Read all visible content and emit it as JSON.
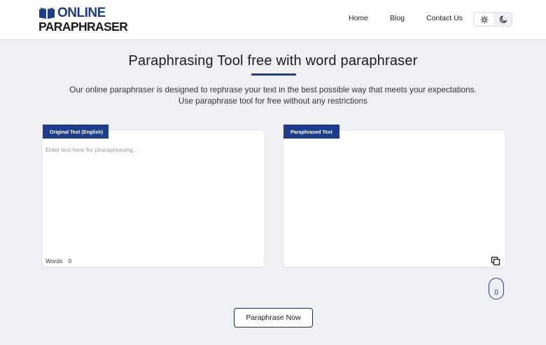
{
  "logo": {
    "line1": "ONLINE",
    "line2": "PARAPHRASER"
  },
  "nav": {
    "items": [
      {
        "label": "Home"
      },
      {
        "label": "Blog"
      },
      {
        "label": "Contact Us"
      }
    ]
  },
  "theme": {
    "light_icon": "sun-icon",
    "dark_icon": "moon-icon",
    "active": "light"
  },
  "main": {
    "title": "Paraphrasing Tool free with word paraphraser",
    "description_line1": "Our online paraphraser is designed to rephrase your text in the best possible way that meets your expectations.",
    "description_line2": "Use paraphrase tool for free without any restrictions"
  },
  "original_panel": {
    "tag": "Original Text (English)",
    "placeholder": "Enter text here for pharaphrasing...",
    "value": "",
    "words_label": "Words",
    "words_count": "0"
  },
  "paraphrased_panel": {
    "tag": "Paraphrased Text",
    "value": "",
    "copy_icon": "copy-icon"
  },
  "scroll_indicator": {
    "value": "0"
  },
  "action": {
    "paraphrase_label": "Paraphrase Now"
  },
  "colors": {
    "brand": "#1f3c88",
    "background": "#eef0f4",
    "panel": "#ffffff"
  }
}
